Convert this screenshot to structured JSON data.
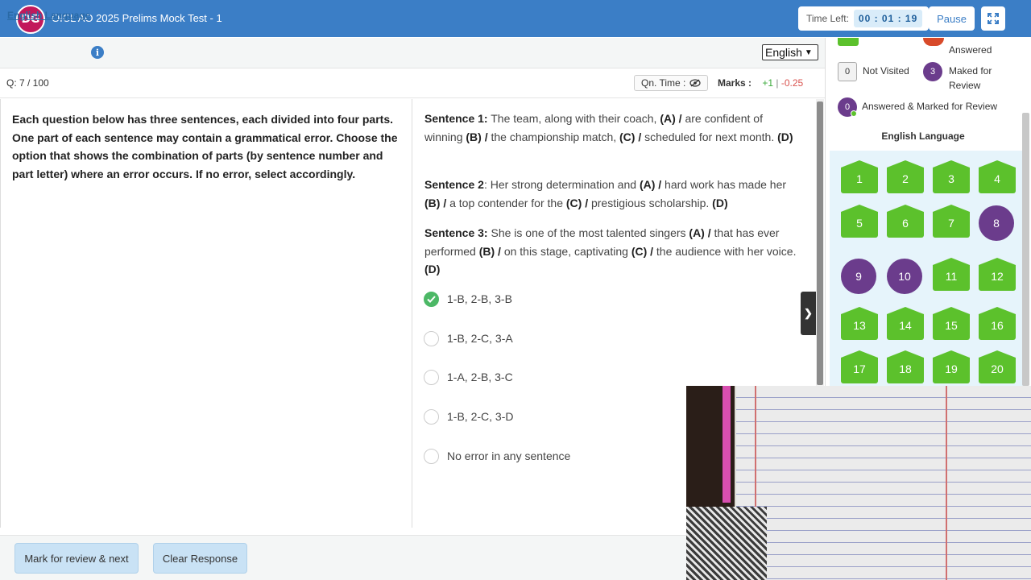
{
  "header": {
    "logo_text": "DG",
    "title": "OICL AO 2025 Prelims Mock Test - 1",
    "time_left_label": "Time Left:",
    "time_left_value": "00 : 01 : 19",
    "pause_label": "Pause",
    "fullscreen_icon": "expand-icon"
  },
  "section": {
    "name": "English Language",
    "info_icon": "i",
    "language": "English"
  },
  "question_meta": {
    "qnum": "Q: 7 / 100",
    "qn_time_label": "Qn. Time :",
    "marks_label": "Marks :",
    "marks_positive": "+1",
    "marks_sep": " | ",
    "marks_negative": "-0.25"
  },
  "directions": "Each question below has three sentences, each divided into four parts. One part of each sentence may contain a grammatical error. Choose the option that shows the combination of parts (by sentence number and part letter) where an error occurs. If no error, select accordingly.",
  "sentences": [
    {
      "label": "Sentence 1:",
      "parts": [
        " The team, along with their coach, ",
        "(A) / ",
        "are confident of winning ",
        "(B) / ",
        "the championship match, ",
        "(C) / ",
        "scheduled for next month. ",
        "(D)"
      ]
    },
    {
      "label": "Sentence 2",
      "parts": [
        ": Her strong determination and ",
        "(A) / ",
        "hard work has made her ",
        "(B) / ",
        "a top contender for the ",
        "(C) / ",
        "prestigious scholarship. ",
        "(D)"
      ]
    },
    {
      "label": "Sentence 3:",
      "parts": [
        " She is one of the most talented singers ",
        "(A) / ",
        "that has ever performed ",
        "(B) / ",
        "on this stage, captivating ",
        "(C) / ",
        "the audience with her voice. ",
        "(D)"
      ]
    }
  ],
  "options": [
    {
      "label": "1-B, 2-B, 3-B",
      "selected": true
    },
    {
      "label": "1-B, 2-C, 3-A",
      "selected": false
    },
    {
      "label": "1-A, 2-B, 3-C",
      "selected": false
    },
    {
      "label": "1-B, 2-C, 3-D",
      "selected": false
    },
    {
      "label": "No error in any sentence",
      "selected": false
    }
  ],
  "footer": {
    "mark_review_label": "Mark for review & next",
    "clear_label": "Clear Response"
  },
  "palette": {
    "legend": {
      "answered_partial": "Answered",
      "not_visited_count": "0",
      "not_visited_label": "Not Visited",
      "marked_count": "3",
      "marked_label_1": "Maked for",
      "marked_label_2": "Review",
      "ans_marked_count": "0",
      "ans_marked_label": "Answered & Marked for Review"
    },
    "section_title": "English Language",
    "questions": [
      {
        "n": "1",
        "status": "answered"
      },
      {
        "n": "2",
        "status": "answered"
      },
      {
        "n": "3",
        "status": "answered"
      },
      {
        "n": "4",
        "status": "answered"
      },
      {
        "n": "5",
        "status": "answered"
      },
      {
        "n": "6",
        "status": "answered"
      },
      {
        "n": "7",
        "status": "answered"
      },
      {
        "n": "8",
        "status": "marked"
      },
      {
        "n": "9",
        "status": "marked"
      },
      {
        "n": "10",
        "status": "marked"
      },
      {
        "n": "11",
        "status": "answered"
      },
      {
        "n": "12",
        "status": "answered"
      },
      {
        "n": "13",
        "status": "answered"
      },
      {
        "n": "14",
        "status": "answered"
      },
      {
        "n": "15",
        "status": "answered"
      },
      {
        "n": "16",
        "status": "answered"
      },
      {
        "n": "17",
        "status": "answered"
      },
      {
        "n": "18",
        "status": "answered"
      },
      {
        "n": "19",
        "status": "answered"
      },
      {
        "n": "20",
        "status": "answered"
      }
    ]
  },
  "colors": {
    "header": "#3b7ec6",
    "answered": "#5cc12c",
    "marked": "#6b3c8c",
    "selected_option": "#4cb866"
  }
}
